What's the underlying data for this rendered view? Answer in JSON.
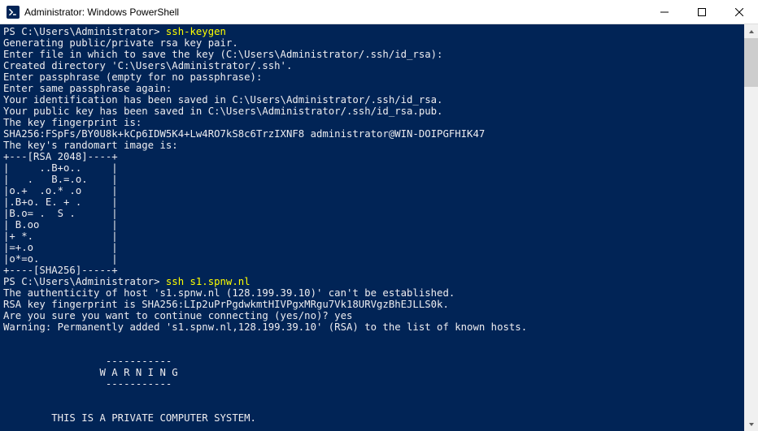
{
  "window": {
    "title": "Administrator: Windows PowerShell"
  },
  "terminal": {
    "prompt1": "PS C:\\Users\\Administrator> ",
    "cmd1": "ssh-keygen",
    "block1": "Generating public/private rsa key pair.\nEnter file in which to save the key (C:\\Users\\Administrator/.ssh/id_rsa):\nCreated directory 'C:\\Users\\Administrator/.ssh'.\nEnter passphrase (empty for no passphrase):\nEnter same passphrase again:\nYour identification has been saved in C:\\Users\\Administrator/.ssh/id_rsa.\nYour public key has been saved in C:\\Users\\Administrator/.ssh/id_rsa.pub.\nThe key fingerprint is:\nSHA256:FSpFs/BY0U8k+kCp6IDW5K4+Lw4RO7kS8c6TrzIXNF8 administrator@WIN-DOIPGFHIK47\nThe key's randomart image is:\n+---[RSA 2048]----+\n|     ..B+o..     |\n|   .   B.=.o.    |\n|o.+  .o.* .o     |\n|.B+o. E. + .     |\n|B.o= .  S .      |\n| B.oo            |\n|+ *.             |\n|=+.o             |\n|o*=o.            |\n+----[SHA256]-----+",
    "prompt2": "PS C:\\Users\\Administrator> ",
    "cmd2": "ssh s1.spnw.nl",
    "block2": "The authenticity of host 's1.spnw.nl (128.199.39.10)' can't be established.\nRSA key fingerprint is SHA256:LIp2uPrPgdwkmtHIVPgxMRgu7Vk18URVgzBhEJLLS0k.\nAre you sure you want to continue connecting (yes/no)? yes\nWarning: Permanently added 's1.spnw.nl,128.199.39.10' (RSA) to the list of known hosts.\n\n\n                 -----------\n                W A R N I N G\n                 -----------\n\n\n        THIS IS A PRIVATE COMPUTER SYSTEM."
  }
}
